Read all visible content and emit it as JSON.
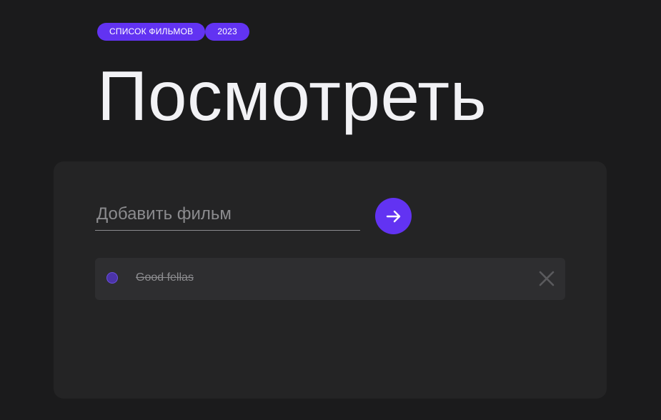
{
  "header": {
    "tags": [
      "СПИСОК ФИЛЬМОВ",
      "2023"
    ],
    "title": "Посмотреть"
  },
  "form": {
    "input_value": "",
    "input_placeholder": "Добавить фильм",
    "add_button_icon": "arrow-right-icon"
  },
  "films": [
    {
      "label": "Good fellas",
      "watched": true,
      "delete_icon": "close-icon"
    }
  ],
  "colors": {
    "background": "#1b1b1c",
    "card": "#242425",
    "item": "#2e2e30",
    "accent": "#6233f2",
    "title": "#f2f2f5",
    "muted": "#8b8b8e"
  }
}
